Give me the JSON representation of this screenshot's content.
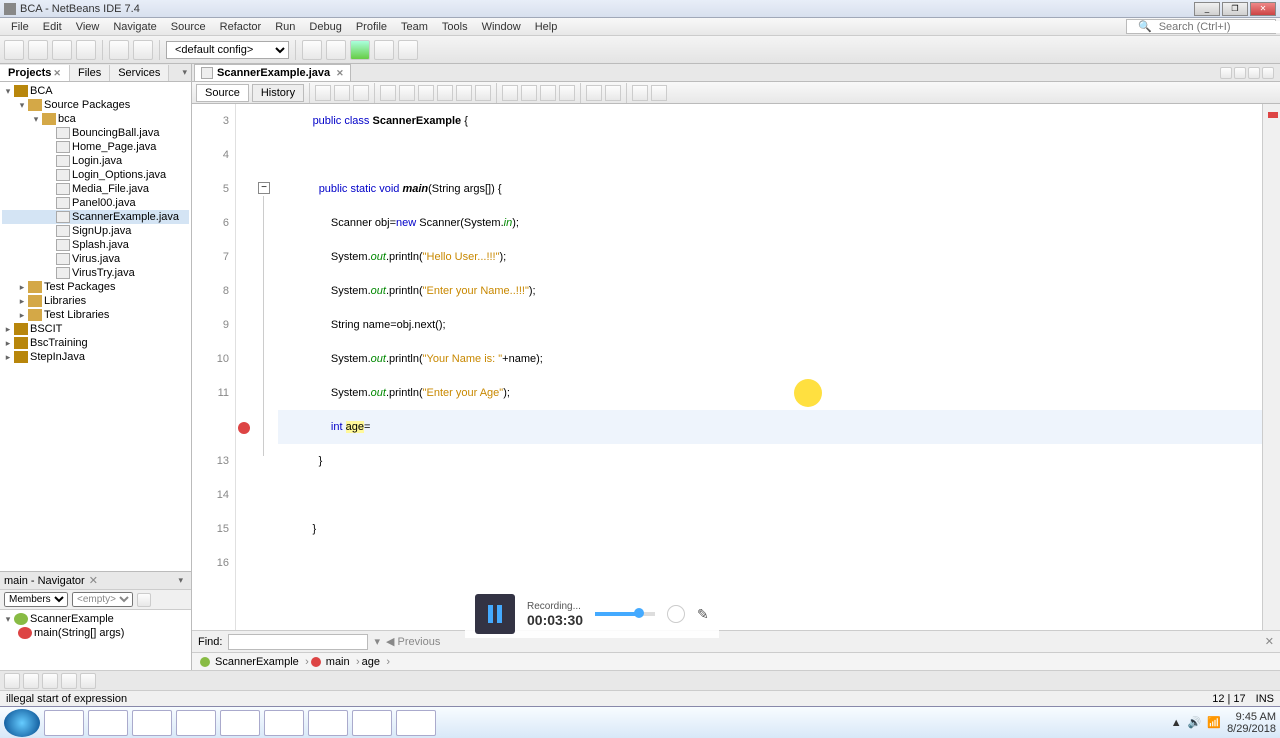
{
  "titlebar": {
    "text": "BCA - NetBeans IDE 7.4"
  },
  "menubar": [
    "File",
    "Edit",
    "View",
    "Navigate",
    "Source",
    "Refactor",
    "Run",
    "Debug",
    "Profile",
    "Team",
    "Tools",
    "Window",
    "Help"
  ],
  "search_placeholder": "Search (Ctrl+I)",
  "toolbar_config": "<default config>",
  "left_tabs": [
    "Projects",
    "Files",
    "Services"
  ],
  "tree": {
    "root": "BCA",
    "pkg_root": "Source Packages",
    "pkg": "bca",
    "files": [
      "BouncingBall.java",
      "Home_Page.java",
      "Login.java",
      "Login_Options.java",
      "Media_File.java",
      "Panel00.java",
      "ScannerExample.java",
      "SignUp.java",
      "Splash.java",
      "Virus.java",
      "VirusTry.java"
    ],
    "other_packages": [
      "Test Packages",
      "Libraries",
      "Test Libraries"
    ],
    "other_projects": [
      "BSCIT",
      "BscTraining",
      "StepInJava"
    ]
  },
  "navigator": {
    "title": "main - Navigator",
    "members_label": "Members",
    "empty_label": "<empty>",
    "class": "ScannerExample",
    "method": "main(String[] args)"
  },
  "editor": {
    "tab": "ScannerExample.java",
    "toolbar_tabs": [
      "Source",
      "History"
    ],
    "line_numbers": [
      "3",
      "4",
      "5",
      "6",
      "7",
      "8",
      "9",
      "10",
      "11",
      "",
      "13",
      "14",
      "15",
      "16"
    ],
    "code_lines": [
      {
        "indent": "          ",
        "tokens": [
          {
            "t": "public class ",
            "c": "kw"
          },
          {
            "t": "ScannerExample",
            "c": "cls"
          },
          {
            "t": " {"
          }
        ]
      },
      {
        "indent": "",
        "tokens": []
      },
      {
        "indent": "            ",
        "tokens": [
          {
            "t": "public static void ",
            "c": "kw"
          },
          {
            "t": "main",
            "c": "mtd"
          },
          {
            "t": "(String args[]) {"
          }
        ]
      },
      {
        "indent": "                ",
        "tokens": [
          {
            "t": "Scanner obj="
          },
          {
            "t": "new ",
            "c": "kw"
          },
          {
            "t": "Scanner(System."
          },
          {
            "t": "in",
            "c": "fld"
          },
          {
            "t": ");"
          }
        ]
      },
      {
        "indent": "                ",
        "tokens": [
          {
            "t": "System."
          },
          {
            "t": "out",
            "c": "fld"
          },
          {
            "t": ".println("
          },
          {
            "t": "\"Hello User...!!!\"",
            "c": "str"
          },
          {
            "t": ");"
          }
        ]
      },
      {
        "indent": "                ",
        "tokens": [
          {
            "t": "System."
          },
          {
            "t": "out",
            "c": "fld"
          },
          {
            "t": ".println("
          },
          {
            "t": "\"Enter your Name..!!!\"",
            "c": "str"
          },
          {
            "t": ");"
          }
        ]
      },
      {
        "indent": "                ",
        "tokens": [
          {
            "t": "String name=obj.next();"
          }
        ]
      },
      {
        "indent": "                ",
        "tokens": [
          {
            "t": "System."
          },
          {
            "t": "out",
            "c": "fld"
          },
          {
            "t": ".println("
          },
          {
            "t": "\"Your Name is: \"",
            "c": "str"
          },
          {
            "t": "+name);"
          }
        ]
      },
      {
        "indent": "                ",
        "tokens": [
          {
            "t": "System."
          },
          {
            "t": "out",
            "c": "fld"
          },
          {
            "t": ".println("
          },
          {
            "t": "\"Enter your Age\"",
            "c": "str"
          },
          {
            "t": ");"
          }
        ]
      },
      {
        "indent": "                ",
        "tokens": [
          {
            "t": "int ",
            "c": "kw"
          },
          {
            "t": "age",
            "c": "hl"
          },
          {
            "t": "="
          }
        ],
        "current": true
      },
      {
        "indent": "            ",
        "tokens": [
          {
            "t": "}"
          }
        ]
      },
      {
        "indent": "",
        "tokens": []
      },
      {
        "indent": "          ",
        "tokens": [
          {
            "t": "}"
          }
        ]
      },
      {
        "indent": "",
        "tokens": []
      }
    ]
  },
  "find_label": "Find:",
  "find_prev": "Previous",
  "breadcrumb": [
    "ScannerExample",
    "main",
    "age"
  ],
  "status": {
    "msg": "illegal start of expression",
    "pos": "12 | 17",
    "ins": "INS"
  },
  "recorder": {
    "label": "Recording...",
    "time": "00:03:30"
  },
  "tray_time": "9:45 AM",
  "tray_date": "8/29/2018"
}
